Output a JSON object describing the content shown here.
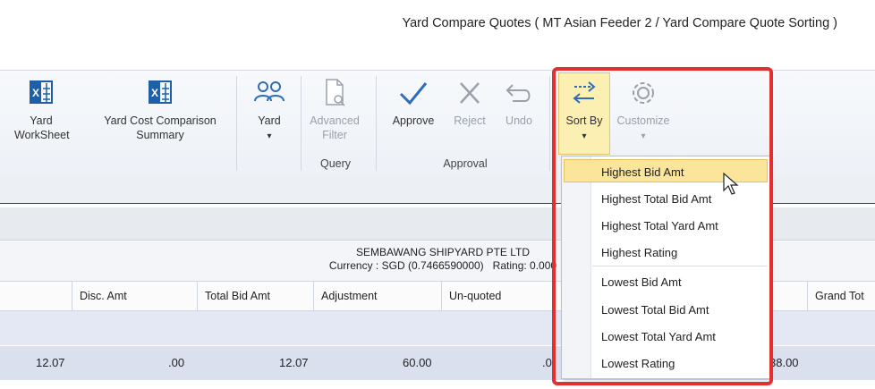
{
  "window": {
    "title": "Yard Compare Quotes ( MT Asian Feeder 2 / Yard Compare Quote Sorting )"
  },
  "ribbon": {
    "buttons": [
      {
        "label_line1": "Yard",
        "label_line2": "WorkSheet",
        "icon": "excel-icon"
      },
      {
        "label_line1": "Yard Cost Comparison",
        "label_line2": "Summary",
        "icon": "excel-icon"
      },
      {
        "label_line1": "Yard",
        "label_line2": "▾",
        "icon": "users-icon"
      },
      {
        "label_line1": "Advanced",
        "label_line2": "Filter",
        "icon": "document-search-icon"
      },
      {
        "label": "Approve",
        "icon": "check-icon"
      },
      {
        "label": "Reject",
        "icon": "close-icon"
      },
      {
        "label": "Undo",
        "icon": "undo-icon"
      },
      {
        "label": "Sort By",
        "arrow": "▾",
        "icon": "sort-arrows-icon"
      },
      {
        "label": "Customize",
        "arrow": "▾",
        "icon": "gear-icon"
      }
    ],
    "groups": {
      "query": "Query",
      "approval": "Approval"
    }
  },
  "company": {
    "name": "SEMBAWANG SHIPYARD PTE LTD",
    "currency_line": "Currency : SGD (0.7466590000)   Rating: 0.000"
  },
  "columns": [
    "Disc. Amt",
    "Total Bid Amt",
    "Adjustment",
    "Un-quoted",
    "Grand Tot"
  ],
  "row": {
    "c0": "12.07",
    "disc": ".00",
    "total_bid": "12.07",
    "adjustment": "60.00",
    "unquoted": ".0",
    "grand": "38.00"
  },
  "sort_menu": {
    "items": [
      "Highest Bid Amt",
      "Highest Total Bid Amt",
      "Highest Total Yard Amt",
      "Highest Rating",
      "Lowest Bid Amt",
      "Lowest Total Bid Amt",
      "Lowest Total Yard Amt",
      "Lowest Rating"
    ],
    "highlighted_index": 0
  },
  "colors": {
    "accent_blue": "#2f6db6",
    "highlight_red": "#e3302f",
    "menu_highlight": "#fbe59a",
    "excel_green_blue": "#1f5fa8"
  }
}
